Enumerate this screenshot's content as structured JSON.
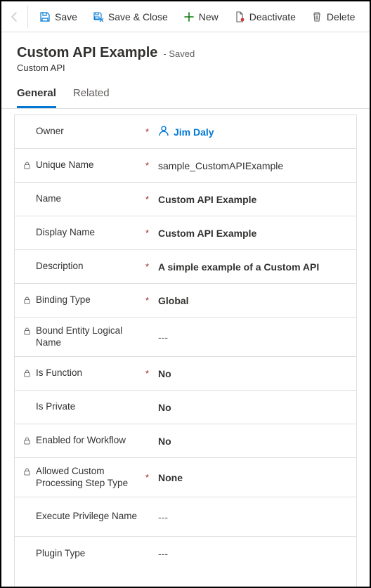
{
  "toolbar": {
    "save": "Save",
    "save_close": "Save & Close",
    "new": "New",
    "deactivate": "Deactivate",
    "delete": "Delete"
  },
  "header": {
    "title": "Custom API Example",
    "status": "- Saved",
    "entity": "Custom API"
  },
  "tabs": {
    "general": "General",
    "related": "Related"
  },
  "fields": {
    "owner_label": "Owner",
    "owner_value": "Jim Daly",
    "unique_name_label": "Unique Name",
    "unique_name_value": "sample_CustomAPIExample",
    "name_label": "Name",
    "name_value": "Custom API Example",
    "display_name_label": "Display Name",
    "display_name_value": "Custom API Example",
    "description_label": "Description",
    "description_value": "A simple example of a Custom API",
    "binding_type_label": "Binding Type",
    "binding_type_value": "Global",
    "bound_entity_label": "Bound Entity Logical Name",
    "bound_entity_value": "---",
    "is_function_label": "Is Function",
    "is_function_value": "No",
    "is_private_label": "Is Private",
    "is_private_value": "No",
    "enabled_workflow_label": "Enabled for Workflow",
    "enabled_workflow_value": "No",
    "allowed_step_label": "Allowed Custom Processing Step Type",
    "allowed_step_value": "None",
    "exec_priv_label": "Execute Privilege Name",
    "exec_priv_value": "---",
    "plugin_type_label": "Plugin Type",
    "plugin_type_value": "---"
  }
}
